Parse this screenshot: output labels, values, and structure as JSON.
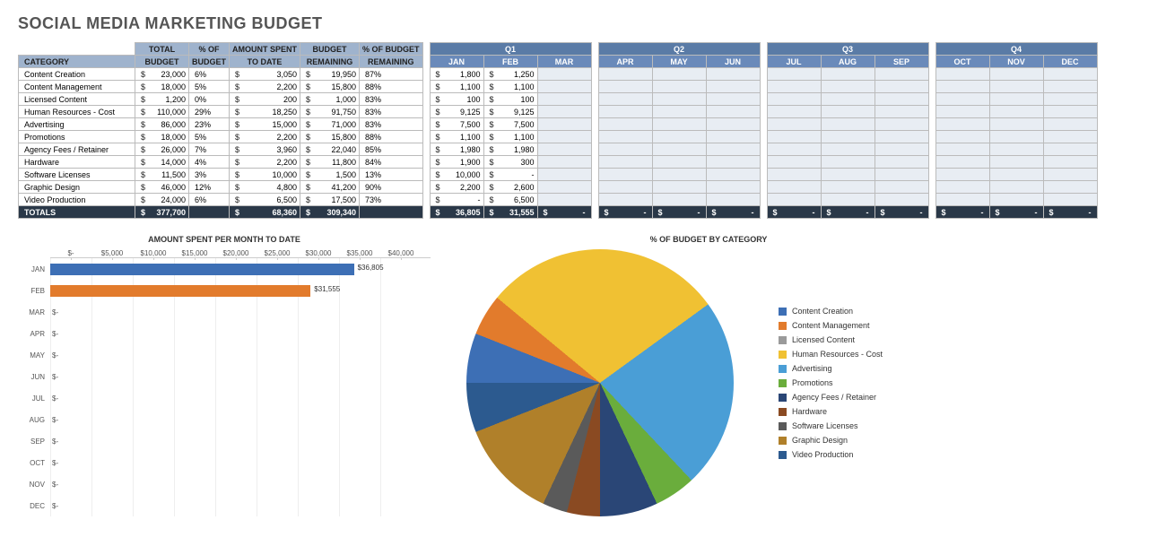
{
  "title": "SOCIAL MEDIA MARKETING BUDGET",
  "headers": {
    "category": "CATEGORY",
    "total_budget": "TOTAL\nBUDGET",
    "pct_budget": "% OF\nBUDGET",
    "amount_spent": "AMOUNT SPENT\nTO DATE",
    "budget_remaining": "BUDGET\nREMAINING",
    "pct_remaining": "% OF BUDGET\nREMAINING",
    "totals": "TOTALS"
  },
  "quarters": [
    {
      "label": "Q1",
      "months": [
        "JAN",
        "FEB",
        "MAR"
      ]
    },
    {
      "label": "Q2",
      "months": [
        "APR",
        "MAY",
        "JUN"
      ]
    },
    {
      "label": "Q3",
      "months": [
        "JUL",
        "AUG",
        "SEP"
      ]
    },
    {
      "label": "Q4",
      "months": [
        "OCT",
        "NOV",
        "DEC"
      ]
    }
  ],
  "rows": [
    {
      "cat": "Content Creation",
      "budget": 23000,
      "pct": "6%",
      "spent": 3050,
      "remain": 19950,
      "pctrem": "87%",
      "jan": 1800,
      "feb": 1250
    },
    {
      "cat": "Content Management",
      "budget": 18000,
      "pct": "5%",
      "spent": 2200,
      "remain": 15800,
      "pctrem": "88%",
      "jan": 1100,
      "feb": 1100
    },
    {
      "cat": "Licensed Content",
      "budget": 1200,
      "pct": "0%",
      "spent": 200,
      "remain": 1000,
      "pctrem": "83%",
      "jan": 100,
      "feb": 100
    },
    {
      "cat": "Human Resources - Cost",
      "budget": 110000,
      "pct": "29%",
      "spent": 18250,
      "remain": 91750,
      "pctrem": "83%",
      "jan": 9125,
      "feb": 9125
    },
    {
      "cat": "Advertising",
      "budget": 86000,
      "pct": "23%",
      "spent": 15000,
      "remain": 71000,
      "pctrem": "83%",
      "jan": 7500,
      "feb": 7500
    },
    {
      "cat": "Promotions",
      "budget": 18000,
      "pct": "5%",
      "spent": 2200,
      "remain": 15800,
      "pctrem": "88%",
      "jan": 1100,
      "feb": 1100
    },
    {
      "cat": "Agency Fees / Retainer",
      "budget": 26000,
      "pct": "7%",
      "spent": 3960,
      "remain": 22040,
      "pctrem": "85%",
      "jan": 1980,
      "feb": 1980
    },
    {
      "cat": "Hardware",
      "budget": 14000,
      "pct": "4%",
      "spent": 2200,
      "remain": 11800,
      "pctrem": "84%",
      "jan": 1900,
      "feb": 300
    },
    {
      "cat": "Software Licenses",
      "budget": 11500,
      "pct": "3%",
      "spent": 10000,
      "remain": 1500,
      "pctrem": "13%",
      "jan": 10000,
      "feb": null
    },
    {
      "cat": "Graphic Design",
      "budget": 46000,
      "pct": "12%",
      "spent": 4800,
      "remain": 41200,
      "pctrem": "90%",
      "jan": 2200,
      "feb": 2600
    },
    {
      "cat": "Video Production",
      "budget": 24000,
      "pct": "6%",
      "spent": 6500,
      "remain": 17500,
      "pctrem": "73%",
      "jan": null,
      "feb": 6500
    }
  ],
  "totals": {
    "budget": 377700,
    "spent": 68360,
    "remain": 309340,
    "jan": 36805,
    "feb": 31555
  },
  "bar_chart": {
    "title": "AMOUNT SPENT PER MONTH TO DATE",
    "ticks": [
      "$-",
      "$5,000",
      "$10,000",
      "$15,000",
      "$20,000",
      "$25,000",
      "$30,000",
      "$35,000",
      "$40,000"
    ],
    "months": [
      "JAN",
      "FEB",
      "MAR",
      "APR",
      "MAY",
      "JUN",
      "JUL",
      "AUG",
      "SEP",
      "OCT",
      "NOV",
      "DEC"
    ],
    "data": {
      "JAN": 36805,
      "FEB": 31555
    },
    "max": 40000,
    "labels": {
      "JAN": "$36,805",
      "FEB": "$31,555"
    }
  },
  "pie_chart": {
    "title": "% OF BUDGET BY CATEGORY",
    "slices": [
      {
        "name": "Content Creation",
        "pct": 6,
        "color": "#3d6fb5"
      },
      {
        "name": "Content Management",
        "pct": 5,
        "color": "#e27b2c"
      },
      {
        "name": "Licensed Content",
        "pct": 0,
        "color": "#9a9a9a"
      },
      {
        "name": "Human Resources - Cost",
        "pct": 29,
        "color": "#f0c133"
      },
      {
        "name": "Advertising",
        "pct": 23,
        "color": "#4a9ed6"
      },
      {
        "name": "Promotions",
        "pct": 5,
        "color": "#6aad3c"
      },
      {
        "name": "Agency Fees / Retainer",
        "pct": 7,
        "color": "#2a4676"
      },
      {
        "name": "Hardware",
        "pct": 4,
        "color": "#8a4a22"
      },
      {
        "name": "Software Licenses",
        "pct": 3,
        "color": "#5a5a5a"
      },
      {
        "name": "Graphic Design",
        "pct": 12,
        "color": "#b0802a"
      },
      {
        "name": "Video Production",
        "pct": 6,
        "color": "#2c5a8f"
      }
    ]
  },
  "chart_data": [
    {
      "type": "bar",
      "title": "AMOUNT SPENT PER MONTH TO DATE",
      "orientation": "horizontal",
      "categories": [
        "JAN",
        "FEB",
        "MAR",
        "APR",
        "MAY",
        "JUN",
        "JUL",
        "AUG",
        "SEP",
        "OCT",
        "NOV",
        "DEC"
      ],
      "values": [
        36805,
        31555,
        0,
        0,
        0,
        0,
        0,
        0,
        0,
        0,
        0,
        0
      ],
      "xlabel": "",
      "ylabel": "",
      "xlim": [
        0,
        40000
      ]
    },
    {
      "type": "pie",
      "title": "% OF BUDGET BY CATEGORY",
      "categories": [
        "Content Creation",
        "Content Management",
        "Licensed Content",
        "Human Resources - Cost",
        "Advertising",
        "Promotions",
        "Agency Fees / Retainer",
        "Hardware",
        "Software Licenses",
        "Graphic Design",
        "Video Production"
      ],
      "values": [
        6,
        5,
        0,
        29,
        23,
        5,
        7,
        4,
        3,
        12,
        6
      ]
    }
  ]
}
